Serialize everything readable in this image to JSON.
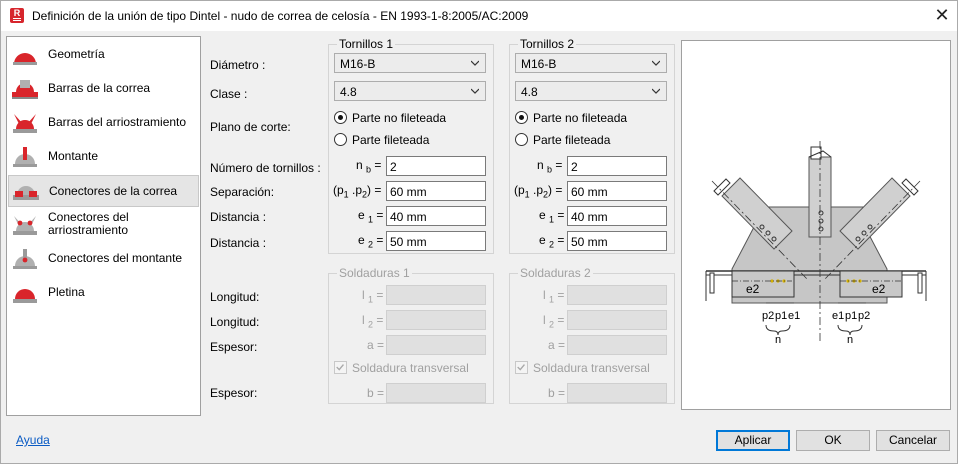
{
  "window": {
    "title": "Definición de la unión de tipo Dintel - nudo de correa de celosía - EN 1993-1-8:2005/AC:2009",
    "app_icon_letter": "R",
    "close_glyph": "✕"
  },
  "sidebar": {
    "items": [
      {
        "label": "Geometría",
        "icon": "geometry-icon"
      },
      {
        "label": "Barras de la correa",
        "icon": "purlin-bars-icon"
      },
      {
        "label": "Barras del arriostramiento",
        "icon": "bracing-bars-icon"
      },
      {
        "label": "Montante",
        "icon": "post-icon"
      },
      {
        "label": "Conectores de la correa",
        "icon": "purlin-connectors-icon",
        "selected": true
      },
      {
        "label": "Conectores del arriostramiento",
        "icon": "bracing-connectors-icon"
      },
      {
        "label": "Conectores del montante",
        "icon": "post-connectors-icon"
      },
      {
        "label": "Pletina",
        "icon": "plate-icon"
      }
    ]
  },
  "labels": {
    "diametro": "Diámetro :",
    "clase": "Clase :",
    "plano": "Plano de corte:",
    "numero": "Número de tornillos :",
    "separacion": "Separación:",
    "distancia1": "Distancia :",
    "distancia2": "Distancia :",
    "longitud1": "Longitud:",
    "longitud2": "Longitud:",
    "espesor1": "Espesor:",
    "espesor2": "Espesor:"
  },
  "symbols": {
    "nb": "n",
    "nb_sub": "b",
    "p_open": "(p",
    "p1_sub": "1",
    "p_mid": " .p",
    "p2_sub": "2",
    "p_close": ")",
    "e": "e",
    "e1_sub": "1",
    "e2_sub": "2",
    "l": "l",
    "l1_sub": "1",
    "l2_sub": "2",
    "a": "a",
    "b": "b",
    "eq": "="
  },
  "bolts1": {
    "title": "Tornillos 1",
    "diameter": "M16-B",
    "class": "4.8",
    "shear_option_1": "Parte no fileteada",
    "shear_option_2": "Parte fileteada",
    "shear_selected": 1,
    "nb": "2",
    "p": "60 mm",
    "e1": "40 mm",
    "e2": "50 mm"
  },
  "bolts2": {
    "title": "Tornillos 2",
    "diameter": "M16-B",
    "class": "4.8",
    "shear_option_1": "Parte no fileteada",
    "shear_option_2": "Parte fileteada",
    "shear_selected": 1,
    "nb": "2",
    "p": "60 mm",
    "e1": "40 mm",
    "e2": "50 mm"
  },
  "welds1": {
    "title": "Soldaduras 1",
    "transversal": "Soldadura transversal",
    "checked": true,
    "enabled": false
  },
  "welds2": {
    "title": "Soldaduras 2",
    "transversal": "Soldadura transversal",
    "checked": true,
    "enabled": false
  },
  "drawing": {
    "e2_left": "e2",
    "e2_right": "e2",
    "left_labels": {
      "p2": "p2",
      "p1": "p1",
      "e1": "e1",
      "n": "n"
    },
    "right_labels": {
      "e1": "e1",
      "p1": "p1",
      "p2": "p2",
      "n": "n"
    }
  },
  "footer": {
    "help": "Ayuda",
    "apply": "Aplicar",
    "ok": "OK",
    "cancel": "Cancelar"
  }
}
